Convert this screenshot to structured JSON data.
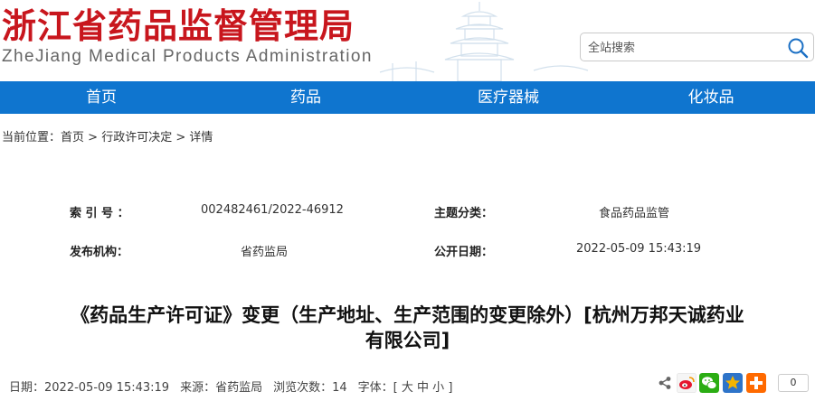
{
  "header": {
    "title": "浙江省药品监督管理局",
    "subtitle": "ZheJiang Medical Products Administration"
  },
  "search": {
    "placeholder": "全站搜索"
  },
  "nav": {
    "items": [
      {
        "label": "首页"
      },
      {
        "label": "药品"
      },
      {
        "label": "医疗器械"
      },
      {
        "label": "化妆品"
      }
    ]
  },
  "breadcrumb": {
    "prefix": "当前位置：",
    "home": "首页",
    "sep1": " > ",
    "section": "行政许可决定",
    "sep2": " > ",
    "current": "详情"
  },
  "meta": {
    "index_label": "索 引 号 ：",
    "index_value": "002482461/2022-46912",
    "topic_label": "主题分类：",
    "topic_value": "食品药品监管",
    "org_label": "发布机构：",
    "org_value": "省药监局",
    "date_label": "公开日期：",
    "date_value": "2022-05-09 15:43:19"
  },
  "article": {
    "title_line1": "《药品生产许可证》变更（生产地址、生产范围的变更除外）[杭州万邦天诚药业",
    "title_line2": "有限公司]"
  },
  "info": {
    "date": "日期：2022-05-09 15:43:19",
    "source": "来源：省药监局",
    "views": "浏览次数：14",
    "font_prefix": "字体：[",
    "font_large": "大",
    "font_medium": "中",
    "font_small": "小",
    "font_suffix": "]"
  },
  "share": {
    "count": "0",
    "colors": {
      "weibo": "#e6162d",
      "wechat": "#2bad13",
      "qzone": "#f4b400",
      "more": "#ff6a00"
    }
  },
  "colors": {
    "brand_red": "#c8161d",
    "nav_blue": "#0f75cf"
  }
}
